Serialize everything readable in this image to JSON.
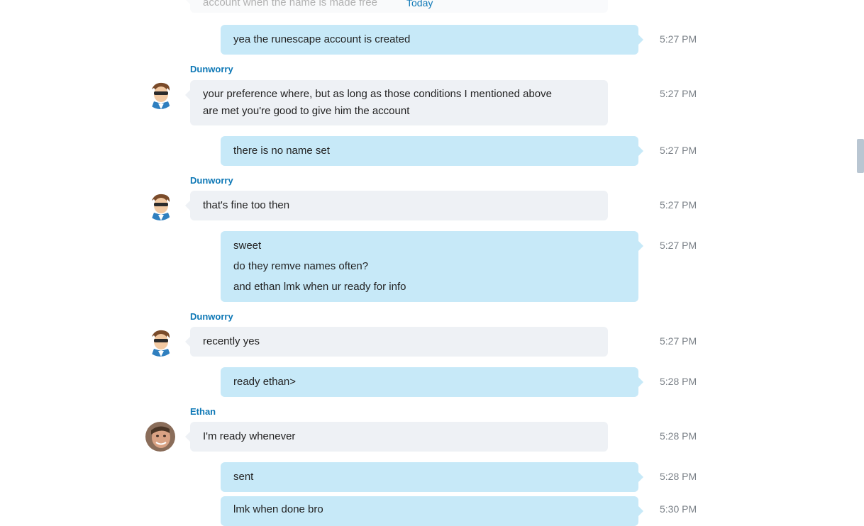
{
  "divider": {
    "label": "Today"
  },
  "top_faded_text": "account when the name is made free",
  "messages": [
    {
      "kind": "out",
      "lines": [
        "yea the runescape account is created"
      ],
      "time": "5:27 PM"
    },
    {
      "kind": "in",
      "sender": "Dunworry",
      "lines": [
        "your preference where, but as long as those conditions I mentioned above",
        "are met you're good to give him the account"
      ],
      "time": "5:27 PM"
    },
    {
      "kind": "out",
      "lines": [
        "there is no name set"
      ],
      "time": "5:27 PM"
    },
    {
      "kind": "in",
      "sender": "Dunworry",
      "lines": [
        "that's fine too then"
      ],
      "time": "5:27 PM"
    },
    {
      "kind": "out",
      "lines": [
        "sweet",
        "do they remve names often?",
        "and ethan lmk when ur ready for info"
      ],
      "time": "5:27 PM"
    },
    {
      "kind": "in",
      "sender": "Dunworry",
      "lines": [
        "recently yes"
      ],
      "time": "5:27 PM"
    },
    {
      "kind": "out",
      "lines": [
        "ready ethan>"
      ],
      "time": "5:28 PM"
    },
    {
      "kind": "in",
      "sender": "Ethan",
      "lines": [
        "I'm ready whenever"
      ],
      "time": "5:28 PM"
    },
    {
      "kind": "out",
      "lines": [
        "sent"
      ],
      "time": "5:28 PM"
    },
    {
      "kind": "out",
      "lines": [
        "lmk when done bro"
      ],
      "time": "5:30 PM"
    }
  ],
  "avatars": {
    "dunworry": "cartoon-avatar-icon",
    "ethan": "user-photo-avatar"
  }
}
